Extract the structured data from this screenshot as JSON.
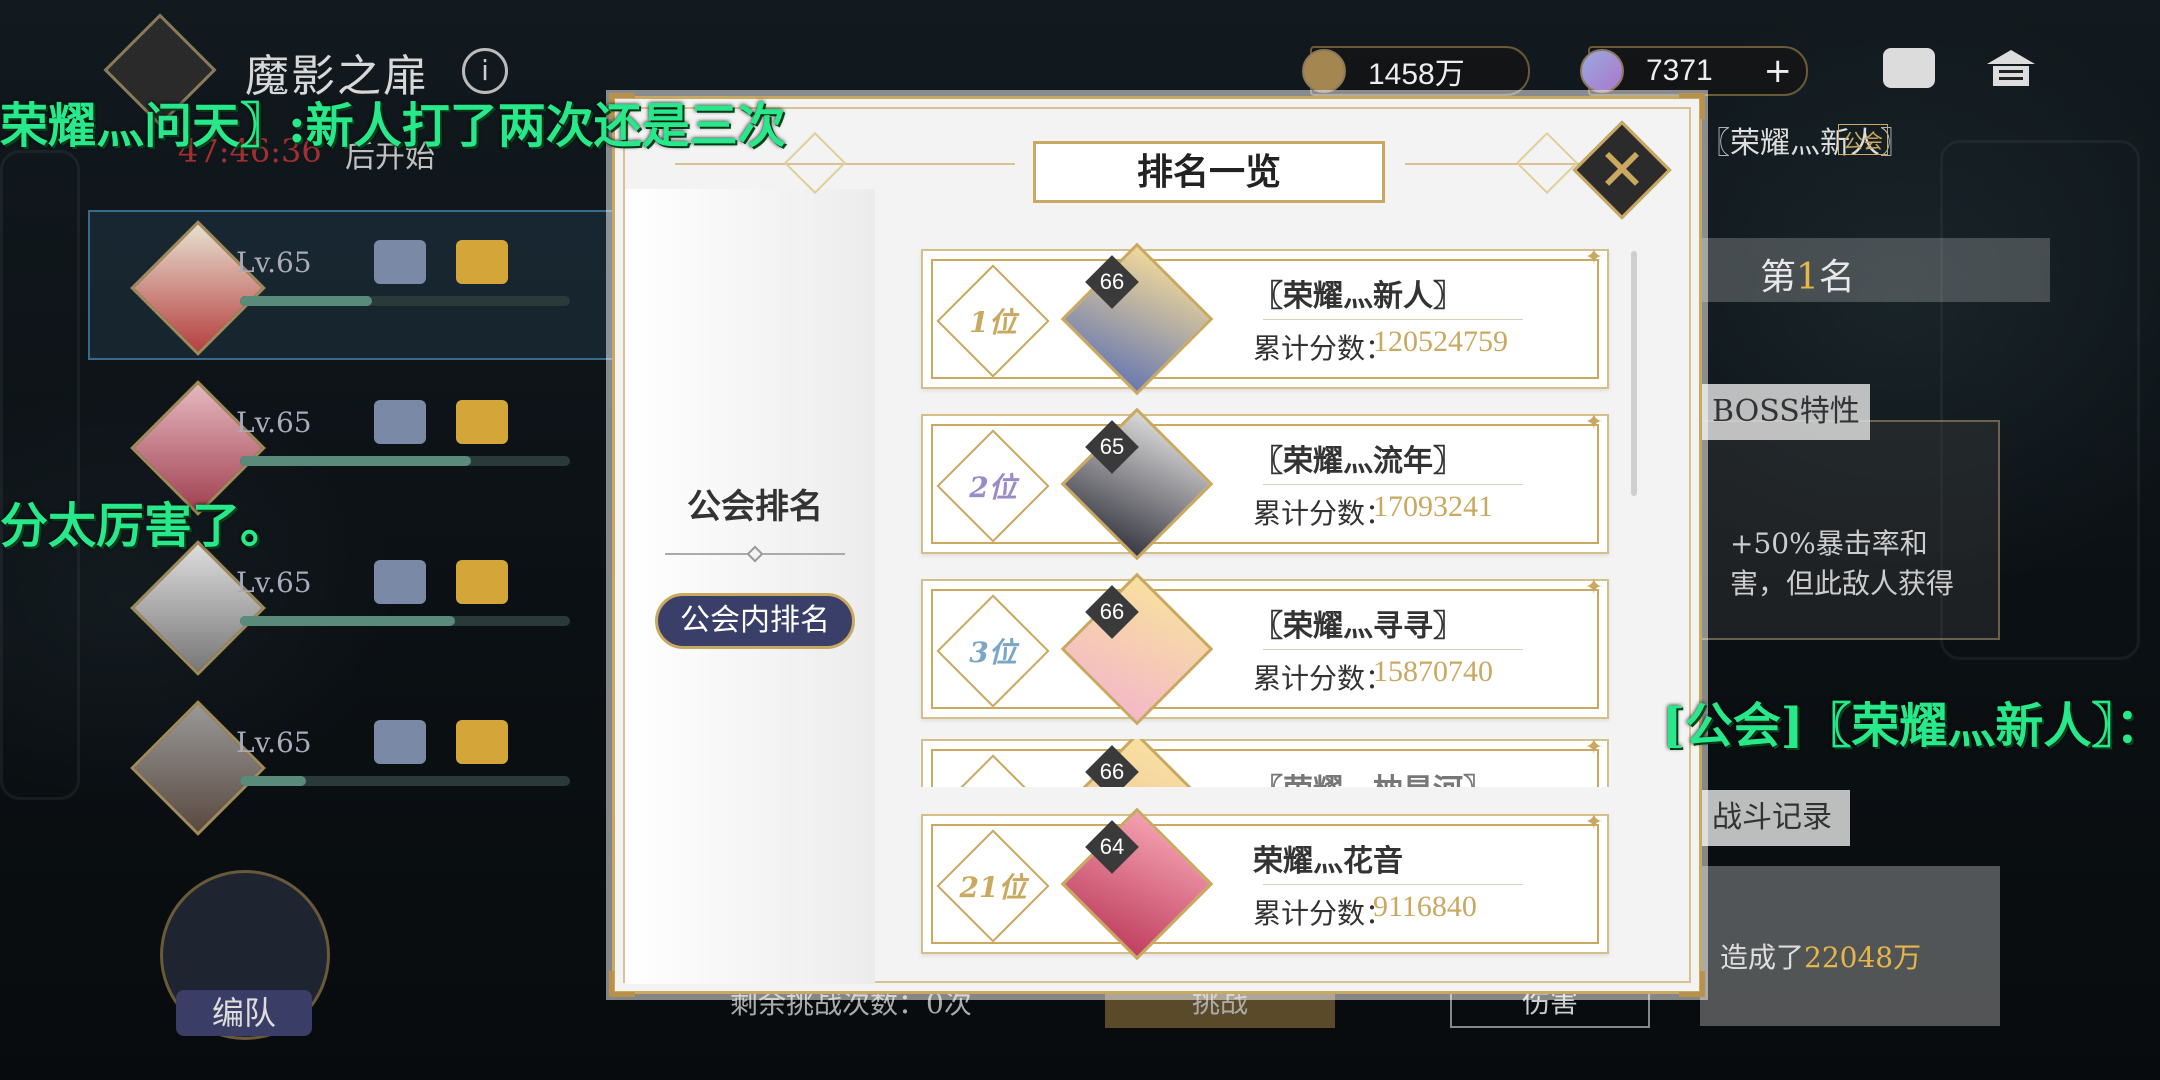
{
  "header": {
    "stage_title": "魔影之扉",
    "countdown": "47:46:36",
    "countdown_suffix": "后开始",
    "currency_gold": "1458万",
    "currency_gem": "7371",
    "gem_plus": "+"
  },
  "team": {
    "members": [
      {
        "level": "Lv.65",
        "progress": 0.4
      },
      {
        "level": "Lv.65",
        "progress": 0.7
      },
      {
        "level": "Lv.65",
        "progress": 0.65
      },
      {
        "level": "Lv.65",
        "progress": 0.2
      }
    ],
    "formation_label": "编队",
    "remaining_text": "剩余挑战次数：0次",
    "challenge_button": "挑战",
    "damage_label": "伤害"
  },
  "right_panel": {
    "player_name": "〖荣耀灬新人〗",
    "guild_badge": "公会",
    "rank_prefix": "第",
    "rank_number": "1",
    "rank_suffix": "名",
    "boss_traits_label": "BOSS特性",
    "trait_line1": "+50%暴击率和",
    "trait_line2": "害，但此敌人获得",
    "battle_record_label": "战斗记录",
    "log_prefix": "造成了",
    "log_value": "22048万"
  },
  "chat": {
    "line1": "荣耀灬问天〗:新人打了两次还是三次",
    "line2": "分太厉害了。",
    "line3": "[公会]〖荣耀灬新人〗："
  },
  "modal": {
    "title": "排名一览",
    "close_icon": "close-icon",
    "tabs": {
      "guild": "公会排名",
      "in_guild": "公会内排名"
    },
    "score_label": "累计分数：",
    "rows": [
      {
        "rank": "1位",
        "level": "66",
        "name": "〖荣耀灬新人〗",
        "score": "120524759"
      },
      {
        "rank": "2位",
        "level": "65",
        "name": "〖荣耀灬流年〗",
        "score": "17093241"
      },
      {
        "rank": "3位",
        "level": "66",
        "name": "〖荣耀灬寻寻〗",
        "score": "15870740"
      },
      {
        "rank": "",
        "level": "66",
        "name": "〖荣耀灬枕星河〗",
        "score": ""
      }
    ],
    "self_row": {
      "rank": "21位",
      "level": "64",
      "name": "荣耀灬花音",
      "score": "9116840"
    }
  },
  "colors": {
    "gold": "#c9a860",
    "chat_green": "#27e88a",
    "rank_highlight": "#e7b64a",
    "tab_active": "#3a3f6a"
  }
}
